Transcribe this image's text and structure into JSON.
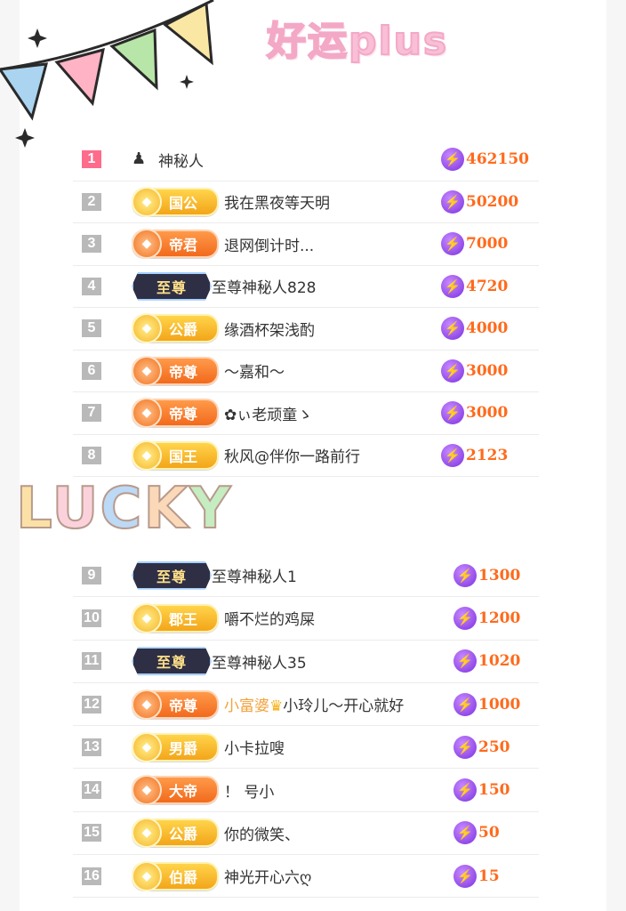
{
  "header": {
    "title": "好运plus"
  },
  "divider": {
    "text": "LUCKY"
  },
  "colors": {
    "score": "#ff6a1c",
    "rank_top": "#ff6b8a",
    "rank": "#b9b9b9",
    "accent_pink": "#f8bfd6"
  },
  "top_list": [
    {
      "rank": "1",
      "badge": "",
      "badge_style": "none",
      "name": "神秘人",
      "score": "462150"
    },
    {
      "rank": "2",
      "badge": "国公",
      "badge_style": "gold",
      "name": "我在黑夜等天明",
      "score": "50200"
    },
    {
      "rank": "3",
      "badge": "帝君",
      "badge_style": "orange",
      "name": "退网倒计时...",
      "score": "7000"
    },
    {
      "rank": "4",
      "badge": "至尊",
      "badge_style": "supreme",
      "name": "至尊神秘人828",
      "score": "4720"
    },
    {
      "rank": "5",
      "badge": "公爵",
      "badge_style": "gold",
      "name": "缘酒杯架浅酌",
      "score": "4000"
    },
    {
      "rank": "6",
      "badge": "帝尊",
      "badge_style": "orange",
      "name": "～嘉和～",
      "score": "3000"
    },
    {
      "rank": "7",
      "badge": "帝尊",
      "badge_style": "orange",
      "name": "✿ぃ老顽童ゝ",
      "score": "3000"
    },
    {
      "rank": "8",
      "badge": "国王",
      "badge_style": "gold",
      "name": "秋风@伴你一路前行",
      "score": "2123"
    }
  ],
  "bottom_list": [
    {
      "rank": "9",
      "badge": "至尊",
      "badge_style": "supreme",
      "name": "至尊神秘人1",
      "score": "1300"
    },
    {
      "rank": "10",
      "badge": "郡王",
      "badge_style": "gold",
      "name": "嚼不烂的鸡屎",
      "score": "1200"
    },
    {
      "rank": "11",
      "badge": "至尊",
      "badge_style": "supreme",
      "name": "至尊神秘人35",
      "score": "1020"
    },
    {
      "rank": "12",
      "badge": "帝尊",
      "badge_style": "orange",
      "name_hl": "小富婆",
      "name": "小玲儿～开心就好",
      "score": "1000"
    },
    {
      "rank": "13",
      "badge": "男爵",
      "badge_style": "gold",
      "name": "小卡拉嗖",
      "score": "250"
    },
    {
      "rank": "14",
      "badge": "大帝",
      "badge_style": "orange",
      "name": "！ 号小",
      "score": "150"
    },
    {
      "rank": "15",
      "badge": "公爵",
      "badge_style": "gold",
      "name": "你的微笑、",
      "score": "50"
    },
    {
      "rank": "16",
      "badge": "伯爵",
      "badge_style": "gold",
      "name": "神光开心六ღ",
      "score": "15"
    }
  ]
}
